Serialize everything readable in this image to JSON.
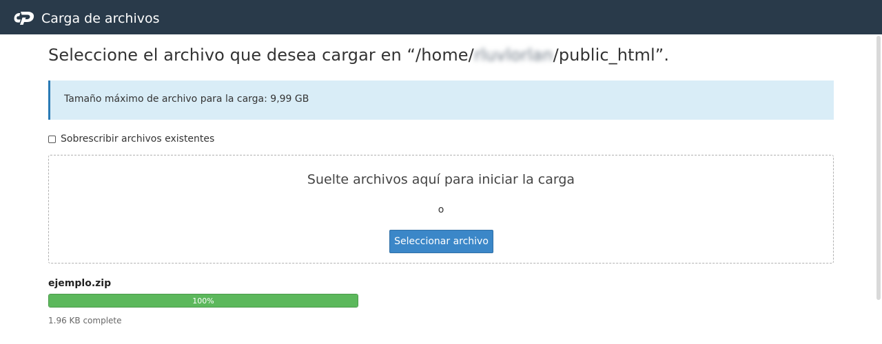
{
  "header": {
    "logo_icon": "cpanel-logo-icon",
    "title": "Carga de archivos"
  },
  "heading": {
    "prefix": "Seleccione el archivo que desea cargar en “/home/",
    "username": "rluvlorlan",
    "suffix": "/public_html”."
  },
  "info": {
    "text": "Tamaño máximo de archivo para la carga: 9,99 GB"
  },
  "overwrite": {
    "label": "Sobrescribir archivos existentes",
    "checked": false
  },
  "dropzone": {
    "drop_text": "Suelte archivos aquí para iniciar la carga",
    "or_text": "o",
    "button_label": "Seleccionar archivo"
  },
  "upload": {
    "file_name": "ejemplo.zip",
    "progress_percent": 100,
    "progress_label": "100%",
    "status": "1.96 KB complete"
  },
  "colors": {
    "header_bg": "#293a4a",
    "info_bg": "#d9edf7",
    "info_border": "#2a7ab5",
    "button_bg": "#3b87c8",
    "progress_fill": "#5cb85c"
  }
}
